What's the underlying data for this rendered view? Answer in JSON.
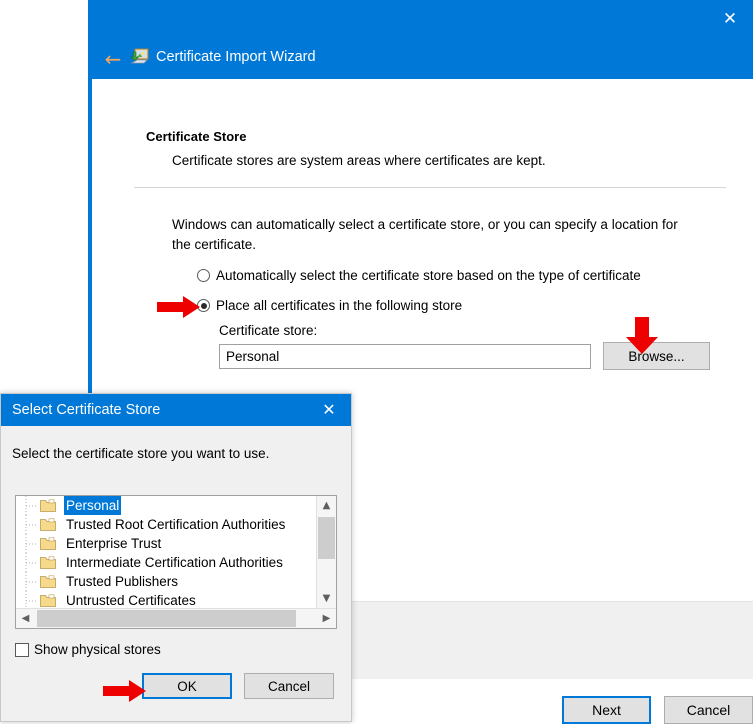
{
  "wizard": {
    "title": "Certificate Import Wizard",
    "app_icon": "certificate-import-icon",
    "back_icon": "back-arrow-icon",
    "close_icon": "close-icon",
    "page_heading": "Certificate Store",
    "page_subheading": "Certificate stores are system areas where certificates are kept.",
    "body_text": "Windows can automatically select a certificate store, or you can specify a location for the certificate.",
    "radio_auto_label": "Automatically select the certificate store based on the type of certificate",
    "radio_auto_selected": false,
    "radio_place_label": "Place all certificates in the following store",
    "radio_place_selected": true,
    "cert_store_label": "Certificate store:",
    "cert_store_value": "Personal",
    "browse_label": "Browse...",
    "next_label": "Next",
    "cancel_label": "Cancel"
  },
  "dialog": {
    "title": "Select Certificate Store",
    "close_icon": "close-icon",
    "prompt": "Select the certificate store you want to use.",
    "tree_items": [
      {
        "label": "Personal",
        "selected": true
      },
      {
        "label": "Trusted Root Certification Authorities",
        "selected": false
      },
      {
        "label": "Enterprise Trust",
        "selected": false
      },
      {
        "label": "Intermediate Certification Authorities",
        "selected": false
      },
      {
        "label": "Trusted Publishers",
        "selected": false
      },
      {
        "label": "Untrusted Certificates",
        "selected": false
      }
    ],
    "scroll_up_icon": "chevron-up-icon",
    "scroll_down_icon": "chevron-down-icon",
    "scroll_left_icon": "chevron-left-icon",
    "scroll_right_icon": "chevron-right-icon",
    "show_physical_label": "Show physical stores",
    "show_physical_checked": false,
    "ok_label": "OK",
    "cancel_label": "Cancel"
  },
  "annotations": {
    "arrow_radio": "red-right-arrow-icon",
    "arrow_browse": "red-down-arrow-icon",
    "arrow_ok": "red-right-arrow-icon",
    "color": "#ee0000"
  },
  "colors": {
    "accent_blue": "#0078d7",
    "window_bg": "#ffffff",
    "dialog_bg": "#f0f0f0",
    "button_bg": "#e1e1e1",
    "annotation_red": "#ee0000"
  }
}
